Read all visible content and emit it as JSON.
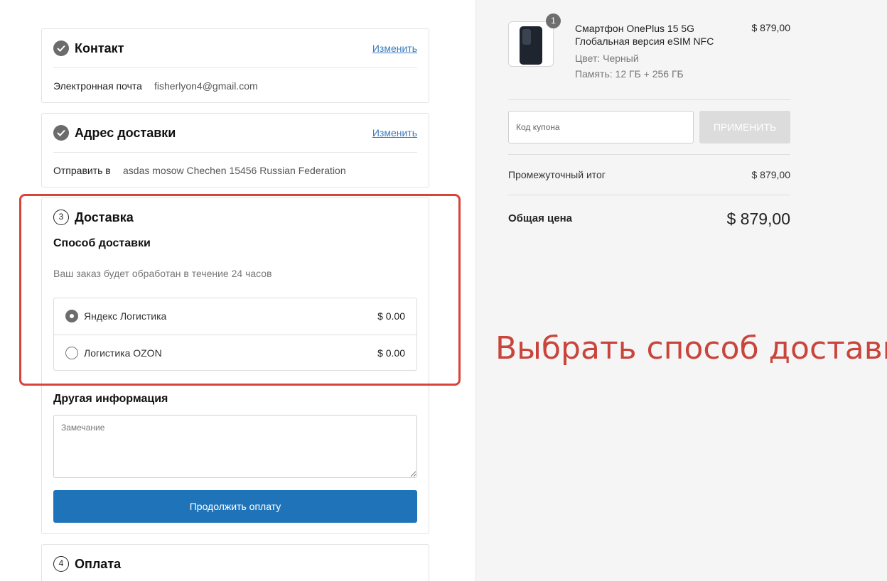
{
  "contact": {
    "title": "Контакт",
    "edit": "Изменить",
    "email_label": "Электронная почта",
    "email_value": "fisherlyon4@gmail.com"
  },
  "address": {
    "title": "Адрес доставки",
    "edit": "Изменить",
    "ship_to_label": "Отправить в",
    "ship_to_value": "asdas mosow Chechen 15456 Russian Federation"
  },
  "delivery": {
    "step": "3",
    "title": "Доставка",
    "method_title": "Способ доставки",
    "processing_note": "Ваш заказ будет обработан в течение 24 часов",
    "options": [
      {
        "name": "Яндекс Логистика",
        "price": "$ 0.00",
        "selected": true
      },
      {
        "name": "Логистика OZON",
        "price": "$ 0.00",
        "selected": false
      }
    ],
    "other_info_title": "Другая информация",
    "remark_placeholder": "Замечание",
    "continue_label": "Продолжить оплату"
  },
  "payment": {
    "step": "4",
    "title": "Оплата"
  },
  "annotation": {
    "text": "Выбрать способ доставки",
    "color": "#c9453c"
  },
  "order": {
    "quantity_badge": "1",
    "product_name": "Смартфон OnePlus 15 5G Глобальная версия eSIM NFC",
    "color": "Цвет: Черный",
    "memory": "Память: 12 ГБ + 256 ГБ",
    "price": "$ 879,00",
    "coupon_placeholder": "Код купона",
    "apply_label": "ПРИМЕНИТЬ",
    "subtotal_label": "Промежуточный итог",
    "subtotal_value": "$ 879,00",
    "total_label": "Общая цена",
    "total_value": "$ 879,00"
  },
  "colors": {
    "accent": "#1f74b9",
    "link": "#3a7bbf",
    "highlight": "#d9443a"
  }
}
